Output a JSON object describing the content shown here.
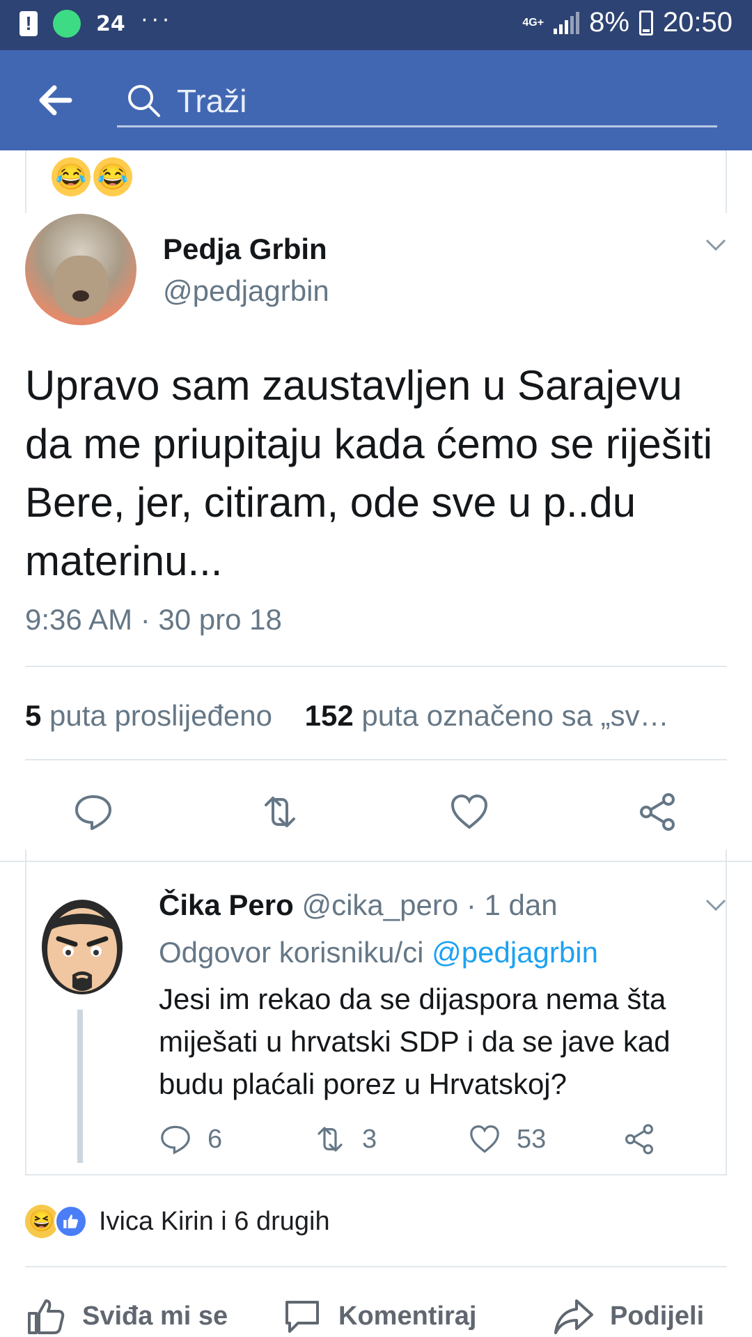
{
  "status_bar": {
    "network": "4G+",
    "battery": "8%",
    "time": "20:50",
    "left_icons": [
      "alert-icon",
      "android-icon",
      "24-icon",
      "more-dots-icon"
    ]
  },
  "app_bar": {
    "search_placeholder": "Traži"
  },
  "tweet": {
    "author_name": "Pedja Grbin",
    "author_handle": "@pedjagrbin",
    "text": "Upravo sam zaustavljen u Sarajevu da me priupitaju kada ćemo se riješiti Bere, jer, citiram, ode sve u p..du materinu...",
    "timestamp": "9:36 AM · 30 pro 18",
    "retweets_count": "5",
    "retweets_label": "puta proslijeđeno",
    "likes_count": "152",
    "likes_label": "puta označeno sa „sv…"
  },
  "reply": {
    "author_name": "Čika Pero",
    "author_meta": "@cika_pero · 1 dan",
    "reply_to_label": "Odgovor korisniku/ci",
    "reply_to_handle": "@pedjagrbin",
    "text": "Jesi im rekao da se dijaspora nema šta miješati u hrvatski SDP i da se jave kad budu plaćali porez u Hrvatskoj?",
    "replies": "6",
    "retweets": "3",
    "likes": "53"
  },
  "facebook": {
    "reactions_text": "Ivica Kirin i 6 drugih",
    "like_label": "Sviđa mi se",
    "comment_label": "Komentiraj",
    "share_label": "Podijeli"
  },
  "colors": {
    "status_bar": "#2d4373",
    "app_bar": "#4267b2",
    "twitter_blue": "#1da1f2",
    "secondary_text": "#657786"
  }
}
